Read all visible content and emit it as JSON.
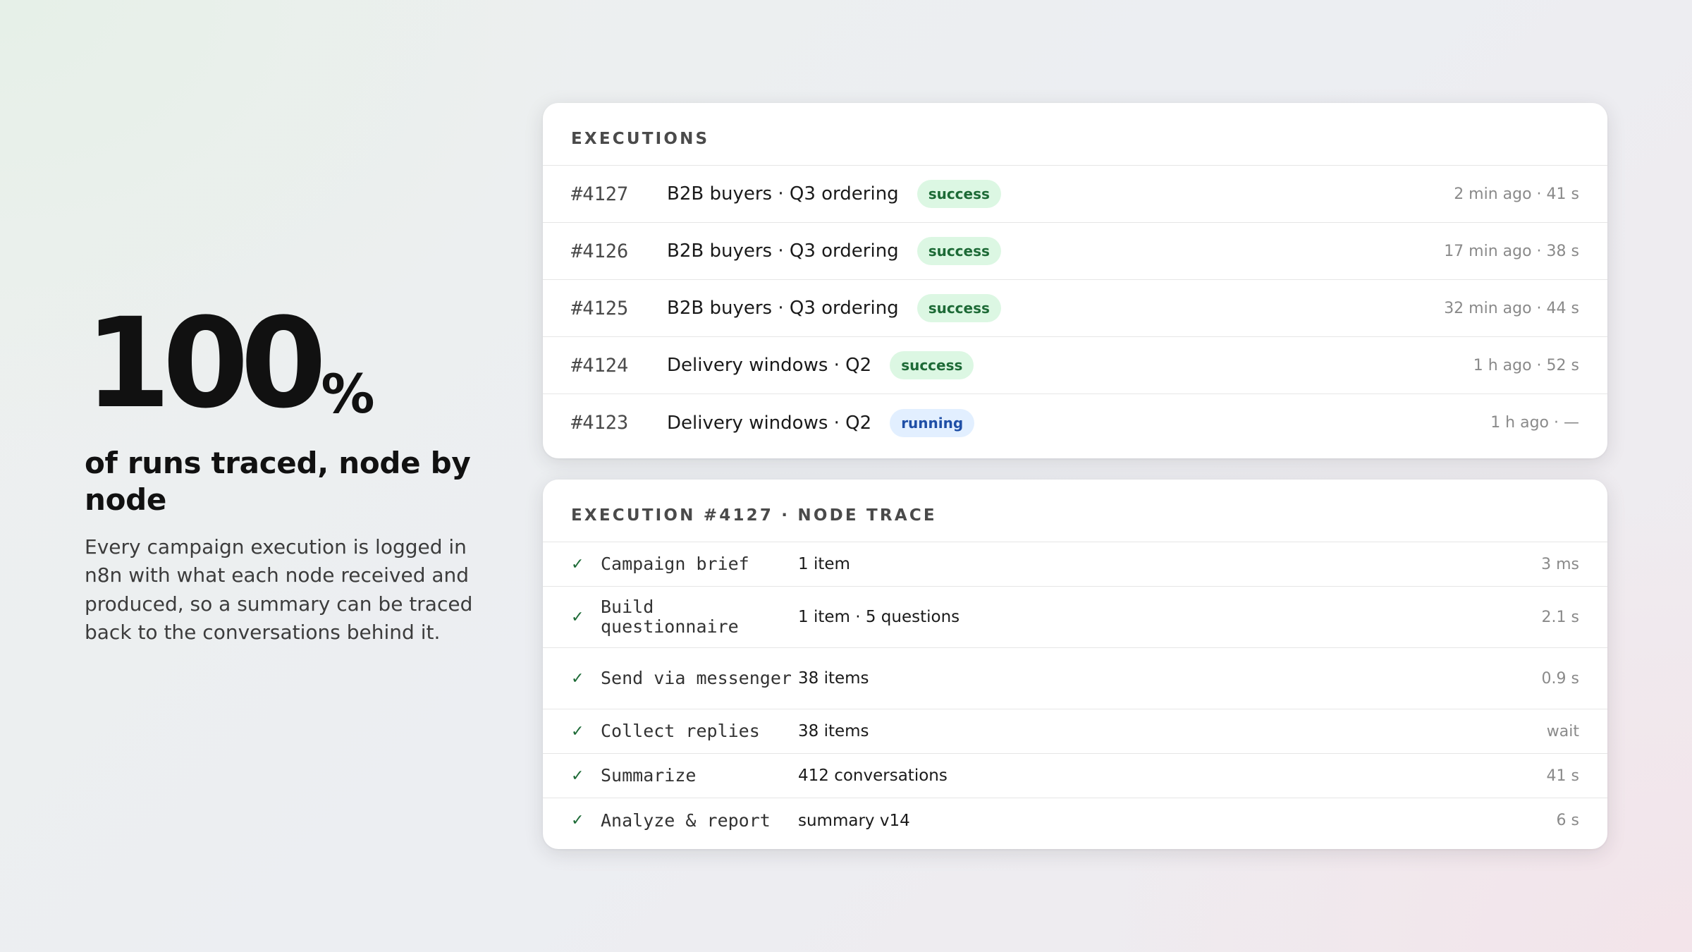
{
  "hero": {
    "number": "100",
    "unit": "%",
    "headline": "of runs traced, node by node",
    "body": "Every campaign execution is logged in n8n with what each node received and produced, so a summary can be traced back to the conversations behind it."
  },
  "executions": {
    "title": "EXECUTIONS",
    "rows": [
      {
        "id": "#4127",
        "name": "B2B buyers · Q3 ordering",
        "status": "success",
        "meta": "2 min ago · 41 s"
      },
      {
        "id": "#4126",
        "name": "B2B buyers · Q3 ordering",
        "status": "success",
        "meta": "17 min ago · 38 s"
      },
      {
        "id": "#4125",
        "name": "B2B buyers · Q3 ordering",
        "status": "success",
        "meta": "32 min ago · 44 s"
      },
      {
        "id": "#4124",
        "name": "Delivery windows · Q2",
        "status": "success",
        "meta": "1 h ago · 52 s"
      },
      {
        "id": "#4123",
        "name": "Delivery windows · Q2",
        "status": "running",
        "meta": "1 h ago · —"
      }
    ]
  },
  "trace": {
    "title": "EXECUTION #4127 · NODE TRACE",
    "check_glyph": "✓",
    "rows": [
      {
        "node": "Campaign brief",
        "io": "1 item",
        "time": "3 ms"
      },
      {
        "node": "Build questionnaire",
        "io": "1 item · 5 questions",
        "time": "2.1 s"
      },
      {
        "node": "Send via messenger",
        "io": "38 items",
        "time": "0.9 s"
      },
      {
        "node": "Collect replies",
        "io": "38 items",
        "time": "wait"
      },
      {
        "node": "Summarize",
        "io": "412 conversations",
        "time": "41 s"
      },
      {
        "node": "Analyze & report",
        "io": "summary v14",
        "time": "6 s"
      }
    ]
  },
  "colors": {
    "success_bg": "#dcf7e3",
    "success_fg": "#1d6a36",
    "running_bg": "#e2efff",
    "running_fg": "#1f4fa6"
  }
}
